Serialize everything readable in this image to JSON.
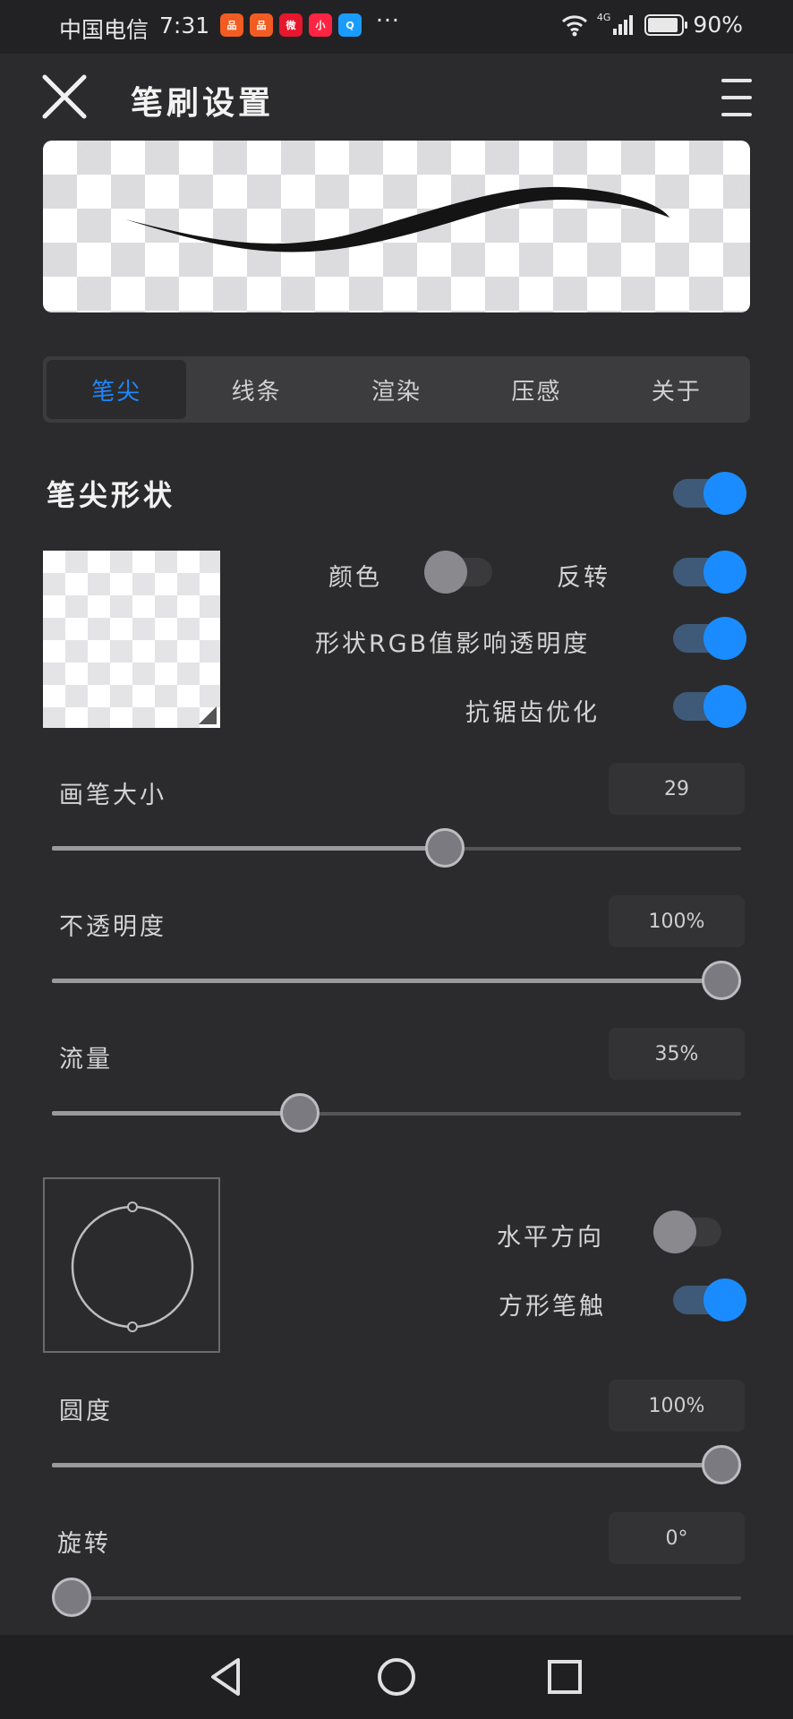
{
  "status_bar": {
    "carrier": "中国电信",
    "time": "7:31",
    "app_icons": [
      {
        "name": "app-icon-1",
        "color": "#f25c22",
        "glyph": "品"
      },
      {
        "name": "app-icon-2",
        "color": "#f25c22",
        "glyph": "品"
      },
      {
        "name": "weibo-icon",
        "color": "#e6162d",
        "glyph": "微"
      },
      {
        "name": "xiaohongshu-icon",
        "color": "#ff2442",
        "glyph": "小"
      },
      {
        "name": "search-app-icon",
        "color": "#1a9cff",
        "glyph": "Q"
      }
    ],
    "more": "···",
    "network": "4G",
    "battery_level": 0.9,
    "battery_percent": "90%"
  },
  "header": {
    "title": "笔刷设置"
  },
  "tabs": [
    {
      "label": "笔尖",
      "active": true
    },
    {
      "label": "线条",
      "active": false
    },
    {
      "label": "渲染",
      "active": false
    },
    {
      "label": "压感",
      "active": false
    },
    {
      "label": "关于",
      "active": false
    }
  ],
  "tip_shape": {
    "title": "笔尖形状",
    "enabled": true,
    "options": {
      "color": {
        "label": "颜色",
        "on": false
      },
      "invert": {
        "label": "反转",
        "on": true
      },
      "rgb_opacity": {
        "label": "形状RGB值影响透明度",
        "on": true
      },
      "antialias": {
        "label": "抗锯齿优化",
        "on": true
      }
    }
  },
  "sliders": {
    "size": {
      "label": "画笔大小",
      "value": "29",
      "fraction": 0.57
    },
    "opacity": {
      "label": "不透明度",
      "value": "100%",
      "fraction": 1.0
    },
    "flow": {
      "label": "流量",
      "value": "35%",
      "fraction": 0.36
    },
    "roundness": {
      "label": "圆度",
      "value": "100%",
      "fraction": 1.0
    },
    "rotation": {
      "label": "旋转",
      "value": "0°",
      "fraction": 0.0
    }
  },
  "tip_orientation": {
    "horizontal": {
      "label": "水平方向",
      "on": false
    },
    "square": {
      "label": "方形笔触",
      "on": true
    }
  },
  "colors": {
    "accent": "#1a8cff",
    "background": "#2b2b2d"
  }
}
